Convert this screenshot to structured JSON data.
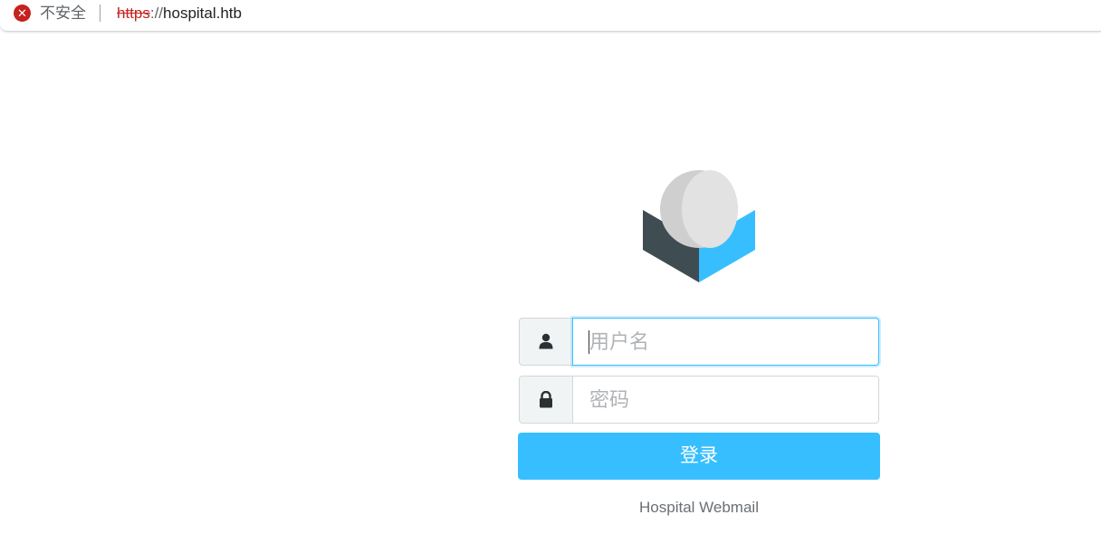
{
  "browser": {
    "security_icon": "error-x-icon",
    "security_label": "不安全",
    "url_scheme": "https",
    "url_separator": "://",
    "url_host": "hospital.htb"
  },
  "logo": {
    "name": "roundcube-logo-icon",
    "colors": {
      "dark": "#3f4c52",
      "light": "#37beff",
      "sphere": "#e0e0e0"
    }
  },
  "login_form": {
    "username": {
      "icon": "user-icon",
      "placeholder": "用户名",
      "value": ""
    },
    "password": {
      "icon": "lock-icon",
      "placeholder": "密码",
      "value": ""
    },
    "submit_label": "登录",
    "accent_color": "#37beff"
  },
  "footer": {
    "text": "Hospital Webmail"
  }
}
